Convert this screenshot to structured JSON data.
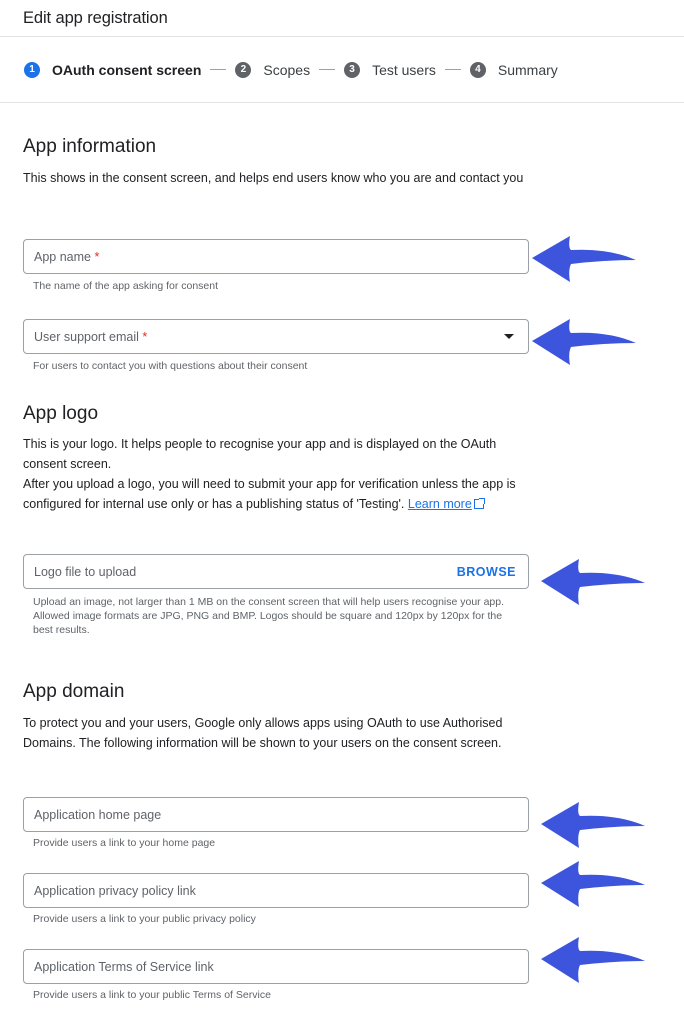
{
  "header": {
    "title": "Edit app registration"
  },
  "stepper": {
    "steps": [
      {
        "num": "1",
        "label": "OAuth consent screen",
        "active": true
      },
      {
        "num": "2",
        "label": "Scopes",
        "active": false
      },
      {
        "num": "3",
        "label": "Test users",
        "active": false
      },
      {
        "num": "4",
        "label": "Summary",
        "active": false
      }
    ]
  },
  "app_information": {
    "title": "App information",
    "description": "This shows in the consent screen, and helps end users know who you are and contact you",
    "app_name": {
      "placeholder": "App name",
      "required_mark": "*",
      "hint": "The name of the app asking for consent",
      "value": ""
    },
    "support_email": {
      "placeholder": "User support email",
      "required_mark": "*",
      "hint": "For users to contact you with questions about their consent",
      "value": ""
    }
  },
  "app_logo": {
    "title": "App logo",
    "description_1": "This is your logo. It helps people to recognise your app and is displayed on the OAuth consent screen.",
    "description_2": "After you upload a logo, you will need to submit your app for verification unless the app is configured for internal use only or has a publishing status of 'Testing'.",
    "learn_more_label": "Learn more",
    "logo_field": {
      "placeholder": "Logo file to upload",
      "browse_label": "BROWSE",
      "hint": "Upload an image, not larger than 1 MB on the consent screen that will help users recognise your app. Allowed image formats are JPG, PNG and BMP. Logos should be square and 120px by 120px for the best results."
    }
  },
  "app_domain": {
    "title": "App domain",
    "description": "To protect you and your users, Google only allows apps using OAuth to use Authorised Domains. The following information will be shown to your users on the consent screen.",
    "home_page": {
      "placeholder": "Application home page",
      "hint": "Provide users a link to your home page"
    },
    "privacy_policy": {
      "placeholder": "Application privacy policy link",
      "hint": "Provide users a link to your public privacy policy"
    },
    "terms_of_service": {
      "placeholder": "Application Terms of Service link",
      "hint": "Provide users a link to your public Terms of Service"
    }
  },
  "annotations": {
    "arrow_color": "#3d55dc"
  }
}
